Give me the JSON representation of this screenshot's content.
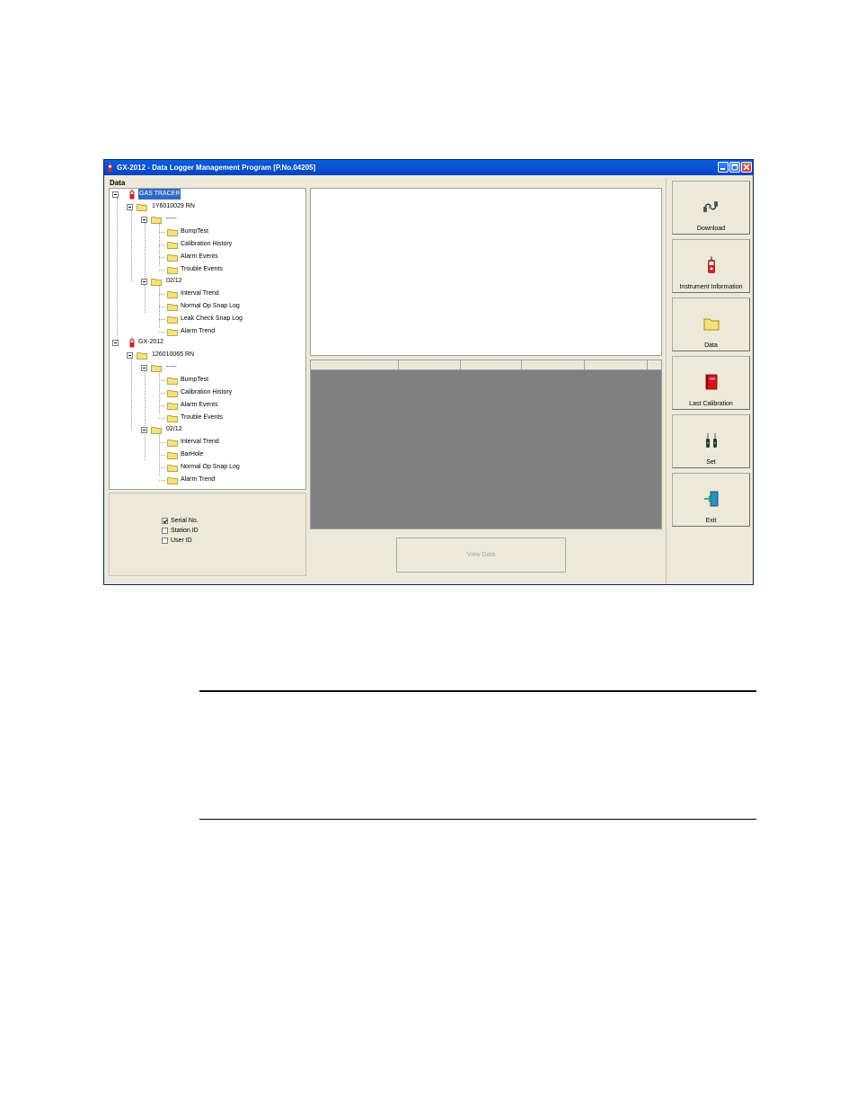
{
  "window": {
    "title": "GX-2012 - Data Logger Management Program [P.No.04205]"
  },
  "data_label": "Data",
  "tree": [
    {
      "label": "GAS TRACER",
      "selected": true
    },
    {
      "label": "1Y6010029 RN"
    },
    {
      "label": "-----"
    },
    {
      "label": "BumpTest"
    },
    {
      "label": "Calibration History"
    },
    {
      "label": "Alarm Events"
    },
    {
      "label": "Trouble Events"
    },
    {
      "label": "02/12"
    },
    {
      "label": "Interval Trend"
    },
    {
      "label": "Normal Op Snap Log"
    },
    {
      "label": "Leak Check Snap Log"
    },
    {
      "label": "Alarm Trend"
    },
    {
      "label": "GX-2012"
    },
    {
      "label": "126010065 RN"
    },
    {
      "label": "-----"
    },
    {
      "label": "BumpTest"
    },
    {
      "label": "Calibration History"
    },
    {
      "label": "Alarm Events"
    },
    {
      "label": "Trouble Events"
    },
    {
      "label": "02/12"
    },
    {
      "label": "Interval Trend"
    },
    {
      "label": "BarHole"
    },
    {
      "label": "Normal Op Snap Log"
    },
    {
      "label": "Alarm Trend"
    }
  ],
  "options": [
    {
      "label": "Serial No.",
      "checked": true
    },
    {
      "label": "Station ID",
      "checked": false
    },
    {
      "label": "User ID",
      "checked": false
    }
  ],
  "view_button": "View Data",
  "side_buttons": [
    {
      "label": "Download",
      "icon": "download-icon"
    },
    {
      "label": "Instrument Information",
      "icon": "instrument-icon"
    },
    {
      "label": "Data",
      "icon": "folder-icon"
    },
    {
      "label": "Last Calibration",
      "icon": "book-icon"
    },
    {
      "label": "Set",
      "icon": "set-icon"
    },
    {
      "label": "Exit",
      "icon": "exit-icon"
    }
  ],
  "colors": {
    "titlebar": "#0a5fe0",
    "selection": "#316ac5",
    "grid_background": "#808080",
    "folder": "#f5e27a"
  }
}
